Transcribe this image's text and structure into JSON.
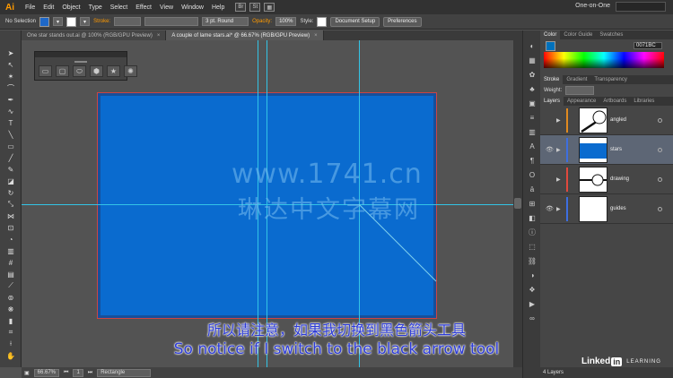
{
  "app": {
    "logo": "Ai",
    "workspace": "One-on-One"
  },
  "menu": [
    "File",
    "Edit",
    "Object",
    "Type",
    "Select",
    "Effect",
    "View",
    "Window",
    "Help"
  ],
  "menubar_icons": [
    "Br",
    "St"
  ],
  "control": {
    "selection": "No Selection",
    "fill_color": "#1f68c8",
    "stroke_label": "Stroke:",
    "stroke_profile": "3 pt. Round",
    "opacity_label": "Opacity:",
    "opacity_value": "100%",
    "style_label": "Style:",
    "document_setup": "Document Setup",
    "preferences": "Preferences"
  },
  "tabs": [
    {
      "label": "One star stands out.ai @ 100% (RGB/GPU Preview)",
      "close": "×",
      "active": false
    },
    {
      "label": "A couple of lame stars.ai* @ 66.67% (RGB/GPU Preview)",
      "close": "×",
      "active": true
    }
  ],
  "shape_panel": {
    "shapes": [
      "rectangle-icon",
      "rounded-rectangle-icon",
      "ellipse-icon",
      "polygon-icon",
      "star-icon",
      "flare-icon"
    ]
  },
  "artboard": {
    "fill": "#0a6bcf",
    "border": "#174f9a"
  },
  "status": {
    "zoom": "66.67%",
    "page": "1",
    "tool": "Rectangle"
  },
  "color_panel": {
    "tabs": [
      "Color",
      "Color Guide",
      "Swatches"
    ],
    "hex": "0071BC"
  },
  "stroke_panel": {
    "tabs": [
      "Stroke",
      "Gradient",
      "Transparency"
    ],
    "weight_label": "Weight:"
  },
  "layers_panel": {
    "tabs": [
      "Layers",
      "Appearance",
      "Artboards",
      "Libraries"
    ],
    "layers": [
      {
        "name": "angled",
        "color": "#e08a1f",
        "visible": false,
        "selected": false
      },
      {
        "name": "stars",
        "color": "#3d6fe0",
        "visible": true,
        "selected": true
      },
      {
        "name": "drawing",
        "color": "#e0493d",
        "visible": false,
        "selected": false
      },
      {
        "name": "guides",
        "color": "#3d6fe0",
        "visible": true,
        "selected": false
      }
    ],
    "footer": "4 Layers"
  },
  "watermark": {
    "line1": "www.1741.cn",
    "line2": "琳达中文字幕网"
  },
  "subtitles": {
    "cn": "所以请注意，如果我切换到黑色箭头工具",
    "en": "So notice if I switch to the black arrow tool"
  },
  "branding": {
    "linked": "Linked",
    "in": "in",
    "learning": "LEARNING"
  }
}
